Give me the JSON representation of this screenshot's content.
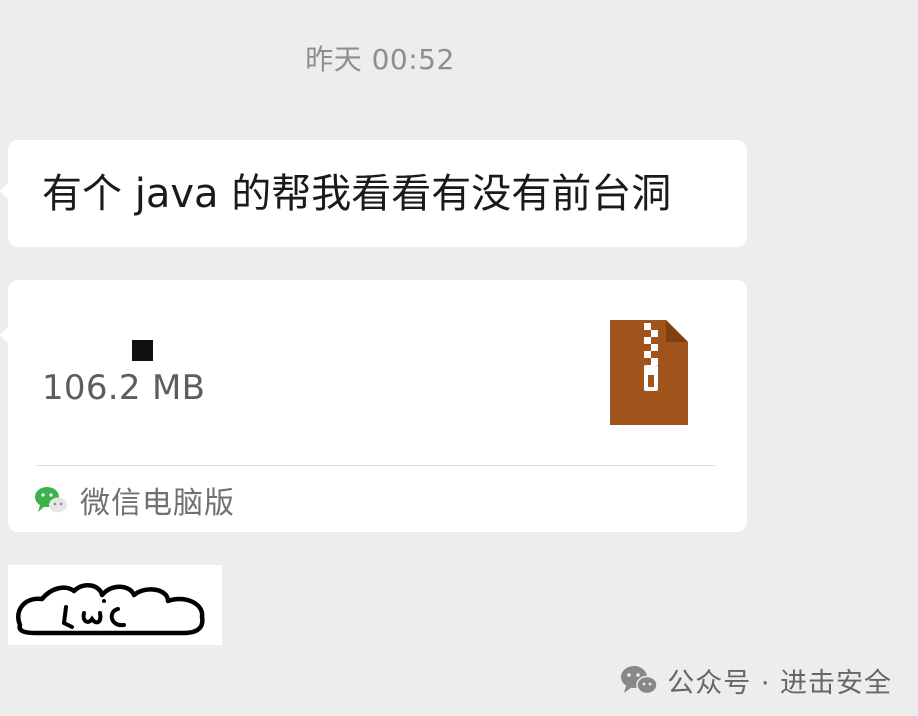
{
  "chat": {
    "timestamp": "昨天 00:52",
    "messages": [
      {
        "type": "text",
        "text": "有个 java 的帮我看看有没有前台洞"
      },
      {
        "type": "file",
        "file_size": "106.2 MB",
        "file_icon": "zip-archive-icon",
        "source_label": "微信电脑版",
        "source_icon": "wechat-icon"
      },
      {
        "type": "sticker",
        "sticker_icon": "cartoon-cat-sticker"
      }
    ]
  },
  "watermark": {
    "text": "公众号 · 进击安全",
    "icon": "wechat-icon"
  },
  "colors": {
    "background": "#ededed",
    "bubble": "#ffffff",
    "zip_icon": "#a0541c",
    "wechat_green": "#3bb24a"
  }
}
